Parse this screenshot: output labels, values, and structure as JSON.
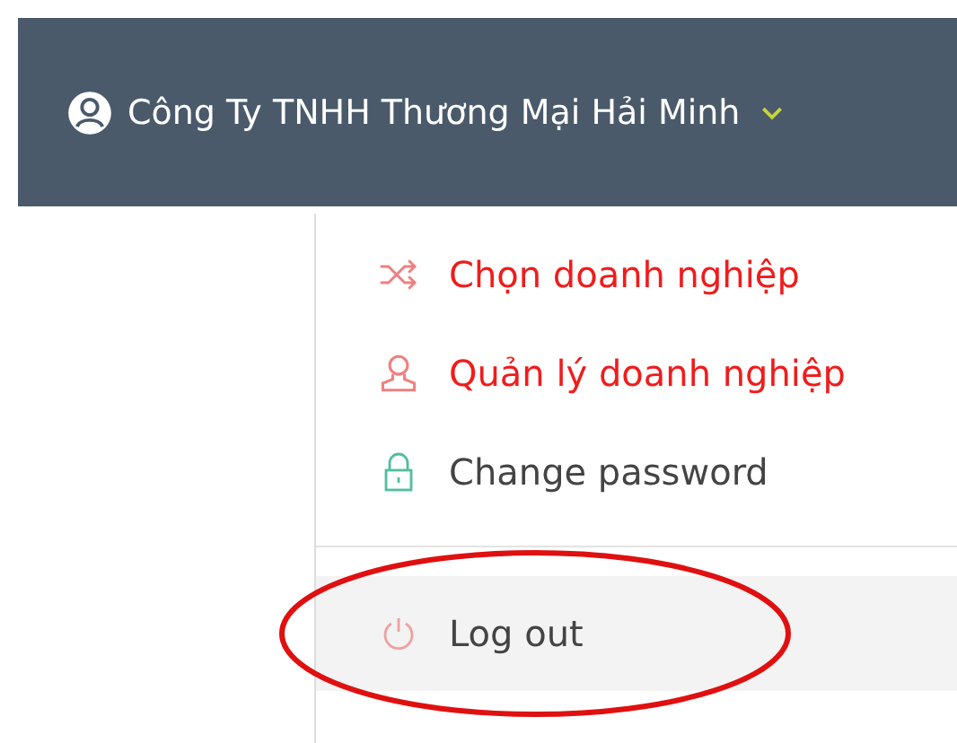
{
  "header": {
    "company": "Công Ty TNHH Thương Mại Hải Minh"
  },
  "menu": {
    "items": [
      {
        "kind": "shuffle",
        "label": "Chọn doanh nghiệp",
        "highlighted": true,
        "hovered": false,
        "circled": false
      },
      {
        "kind": "user",
        "label": "Quản lý doanh nghiệp",
        "highlighted": true,
        "hovered": false,
        "circled": false
      },
      {
        "kind": "lock",
        "label": "Change password",
        "highlighted": false,
        "hovered": false,
        "circled": false
      },
      {
        "kind": "power",
        "label": "Log out",
        "highlighted": false,
        "hovered": true,
        "circled": true
      }
    ]
  }
}
